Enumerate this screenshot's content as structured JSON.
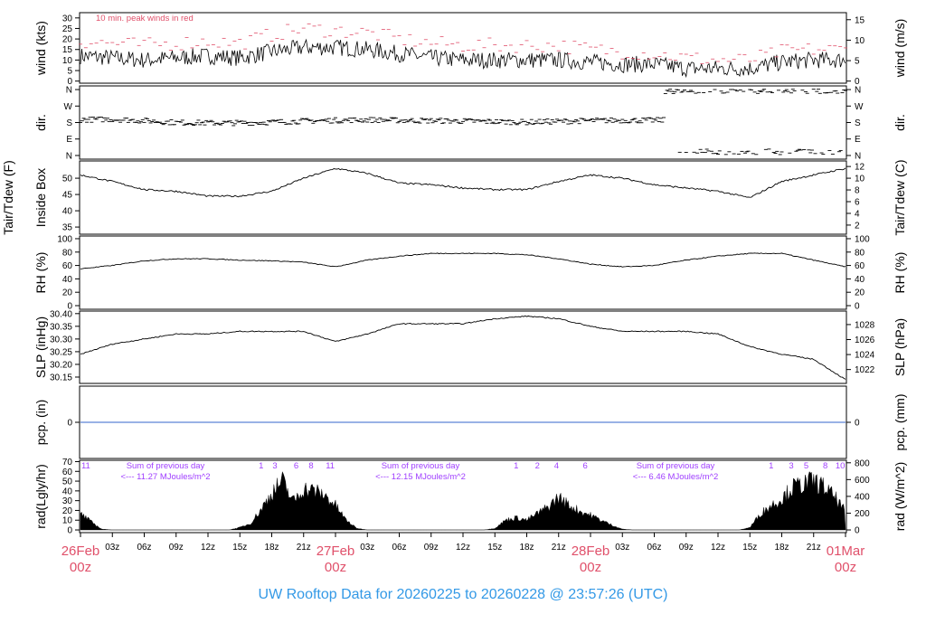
{
  "title": "UW Rooftop Data for 20260225  to  20260228 @ 23:57:26  (UTC)",
  "chart_data": {
    "type": "line",
    "x_hours": [
      0,
      3,
      6,
      9,
      12,
      15,
      18,
      21,
      24,
      27,
      30,
      33,
      36,
      39,
      42,
      45,
      48,
      51,
      54,
      57,
      60,
      63,
      66,
      69,
      72
    ],
    "x_major": [
      {
        "h": 0,
        "d": "26Feb",
        "t": "00z"
      },
      {
        "h": 24,
        "d": "27Feb",
        "t": "00z"
      },
      {
        "h": 48,
        "d": "28Feb",
        "t": "00z"
      },
      {
        "h": 72,
        "d": "01Mar",
        "t": "00z"
      }
    ],
    "x_minor": [
      "03z",
      "06z",
      "09z",
      "12z",
      "15z",
      "18z",
      "21z"
    ],
    "panels": [
      {
        "id": "wind",
        "ylabel": "wind (kts)",
        "ylabel2": "wind (m/s)",
        "ylim": [
          -1,
          32.5
        ],
        "ticks": [
          0,
          5,
          10,
          15,
          20,
          25,
          30
        ],
        "ticks2": [
          0,
          5,
          10,
          15
        ],
        "note": "10 min. peak winds in red",
        "series": [
          {
            "name": "wind",
            "values": [
              12,
              11,
              10,
              11,
              12,
              11,
              14,
              16,
              16,
              15,
              13,
              11,
              10,
              10,
              10,
              10,
              9,
              8,
              8,
              6,
              6,
              6,
              9,
              10,
              10
            ]
          },
          {
            "name": "peak",
            "color": "#e0506a",
            "values": [
              19,
              18,
              17,
              18,
              19,
              18,
              22,
              25,
              24,
              23,
              20,
              18,
              17,
              17,
              17,
              17,
              15,
              14,
              13,
              11,
              10,
              10,
              14,
              15,
              15
            ]
          }
        ]
      },
      {
        "id": "dir",
        "ylabel": "dir.",
        "ylim": [
          -20,
          380
        ],
        "ticklabels": [
          "N",
          "E",
          "S",
          "W",
          "N"
        ],
        "ticks": [
          0,
          90,
          180,
          270,
          360
        ],
        "series": [
          {
            "name": "dir",
            "values": [
              195,
              198,
              190,
              180,
              178,
              178,
              182,
              188,
              192,
              195,
              192,
              190,
              188,
              185,
              182,
              186,
              190,
              192,
              192,
              195,
              355,
              350,
              355,
              345,
              340
            ]
          }
        ],
        "alt_dir_after_hour": 55,
        "alt_dir": 20
      },
      {
        "id": "temp",
        "ylabel": "Tair/Tdew (F)",
        "ylabel_b": "Inside Box",
        "ylabel2": "Tair/Tdew (C)",
        "ylim": [
          32.8,
          55.3
        ],
        "ticks": [
          35,
          40,
          45,
          50
        ],
        "ticks2": [
          2,
          4,
          6,
          8,
          10,
          12
        ],
        "series": [
          {
            "name": "Tair",
            "values": [
              51,
              49,
              46.5,
              46,
              44.5,
              44.5,
              46,
              50,
              53,
              51.5,
              48.5,
              48,
              47,
              46.5,
              46.5,
              49,
              51,
              50,
              48,
              47,
              46,
              44,
              49,
              51,
              53
            ]
          }
        ]
      },
      {
        "id": "rh",
        "ylabel": "RH (%)",
        "ylabel2": "RH (%)",
        "ylim": [
          -5.4,
          104
        ],
        "ticks": [
          0,
          20,
          40,
          60,
          80,
          100
        ],
        "ticks2": [
          0,
          20,
          40,
          60,
          80,
          100
        ],
        "series": [
          {
            "name": "RH",
            "values": [
              55,
              60,
              67,
              70,
              70,
              68,
              67,
              65,
              58,
              68,
              74,
              78,
              78,
              78,
              76,
              70,
              62,
              58,
              60,
              68,
              74,
              78,
              78,
              68,
              58
            ]
          }
        ]
      },
      {
        "id": "slp",
        "ylabel": "SLP (inHg)",
        "ylabel2": "SLP (hPa)",
        "ylim": [
          30.125,
          30.41
        ],
        "ticks": [
          30.15,
          30.2,
          30.25,
          30.3,
          30.35,
          30.4
        ],
        "ticks2": [
          1022,
          1024,
          1026,
          1028
        ],
        "series": [
          {
            "name": "SLP",
            "values": [
              30.24,
              30.28,
              30.3,
              30.32,
              30.32,
              30.33,
              30.33,
              30.33,
              30.29,
              30.32,
              30.36,
              30.36,
              30.36,
              30.38,
              30.39,
              30.38,
              30.35,
              30.33,
              30.33,
              30.33,
              30.32,
              30.27,
              30.24,
              30.22,
              30.14
            ]
          }
        ]
      },
      {
        "id": "pcp",
        "ylabel": "pcp. (in)",
        "ylabel2": "pcp. (mm)",
        "ylim": [
          -1,
          1
        ],
        "ticks": [
          0
        ],
        "ticks2": [
          0
        ],
        "series": [
          {
            "name": "pcp",
            "color": "#3366cc",
            "values": [
              0,
              0
            ]
          }
        ]
      },
      {
        "id": "rad",
        "ylabel": "rad(Lgly/hr)",
        "ylabel2": "rad (W/m^2)",
        "ylim": [
          -32,
          830
        ],
        "ticks": [
          0,
          10,
          20,
          30,
          40,
          50,
          60,
          70
        ],
        "ticks2": [
          0,
          200,
          400,
          600,
          800
        ],
        "hourly_wm2": [
          200,
          100,
          10,
          0,
          0,
          0,
          0,
          0,
          0,
          0,
          0,
          0,
          0,
          0,
          0,
          30,
          80,
          250,
          450,
          600,
          350,
          500,
          480,
          420,
          300,
          120,
          20,
          0,
          0,
          0,
          0,
          0,
          0,
          0,
          0,
          0,
          0,
          0,
          0,
          20,
          120,
          150,
          120,
          200,
          280,
          400,
          300,
          230,
          180,
          120,
          60,
          10,
          0,
          0,
          0,
          0,
          0,
          0,
          0,
          0,
          0,
          0,
          0,
          30,
          200,
          300,
          380,
          520,
          560,
          600,
          520,
          400,
          220
        ],
        "sums": [
          {
            "h": 8,
            "l1": "Sum of previous day",
            "l2": "<--- 11.27 MJoules/m^2"
          },
          {
            "h": 32,
            "l1": "Sum of previous day",
            "l2": "<--- 12.15 MJoules/m^2"
          },
          {
            "h": 56,
            "l1": "Sum of previous day",
            "l2": "<--- 6.46 MJoules/m^2"
          }
        ],
        "hour_marks": [
          {
            "h": 0.5,
            "t": "11"
          },
          {
            "h": 17,
            "t": "1"
          },
          {
            "h": 18.3,
            "t": "3"
          },
          {
            "h": 20.3,
            "t": "6"
          },
          {
            "h": 21.7,
            "t": "8"
          },
          {
            "h": 23.5,
            "t": "11"
          },
          {
            "h": 41,
            "t": "1"
          },
          {
            "h": 43,
            "t": "2"
          },
          {
            "h": 44.8,
            "t": "4"
          },
          {
            "h": 47.5,
            "t": "6"
          },
          {
            "h": 65,
            "t": "1"
          },
          {
            "h": 66.9,
            "t": "3"
          },
          {
            "h": 68.3,
            "t": "5"
          },
          {
            "h": 70.1,
            "t": "8"
          },
          {
            "h": 71.5,
            "t": "10"
          }
        ]
      }
    ]
  }
}
